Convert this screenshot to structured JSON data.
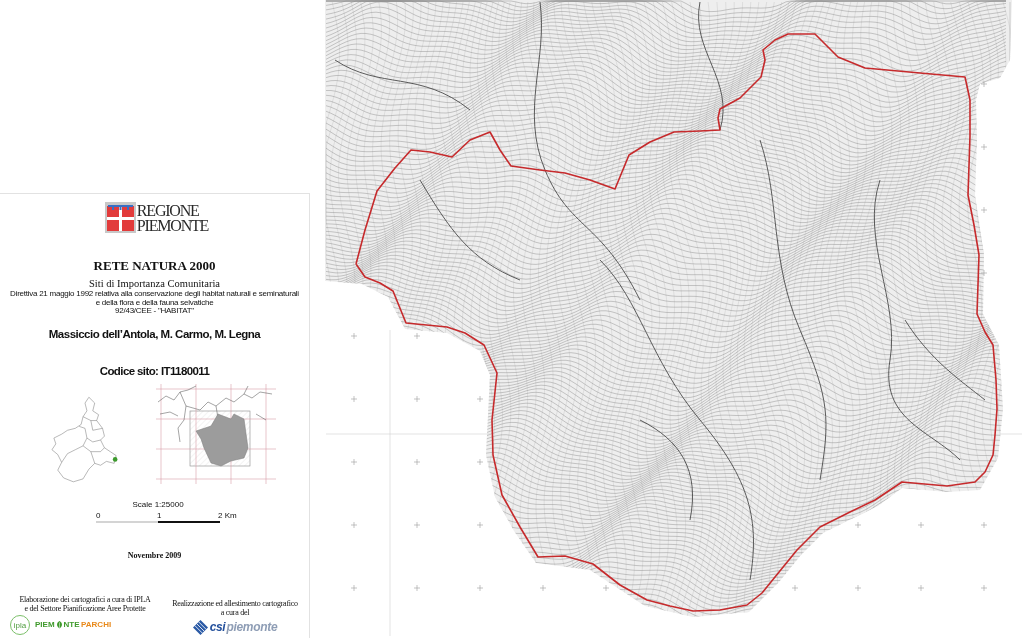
{
  "title_block": {
    "logo": {
      "lines": [
        "REGIONE",
        "PIEMONTE"
      ]
    },
    "title": "RETE NATURA 2000",
    "subtitle": "Siti di Importanza Comunitaria",
    "directive": [
      "Direttiva 21 maggio 1992 relativa alla conservazione degli habitat naturali e seminaturali",
      "e della flora e della fauna selvatiche",
      "92/43/CEE - \"HABITAT\""
    ],
    "site_name": "Massiccio dell’Antola, M. Carmo, M. Legna",
    "site_code": "Codice sito: IT1180011"
  },
  "scale_bar": {
    "label": "Scale 1:25000",
    "ticks": [
      "0",
      "1",
      "2 Km"
    ]
  },
  "date": "Novembre 2009",
  "credits": {
    "left": {
      "lines": [
        "Elaborazione dei cartografici a cura di IPLA",
        "e del Settore Pianificazione Aree Protette"
      ],
      "badge": "ipla",
      "wordmark": [
        "PIEM",
        "NTE",
        "PARCHI"
      ]
    },
    "right": {
      "lines": [
        "Realizzazione ed allestimento cartografico a cura del"
      ],
      "wordmark": [
        "csi",
        "piemonte"
      ]
    }
  }
}
